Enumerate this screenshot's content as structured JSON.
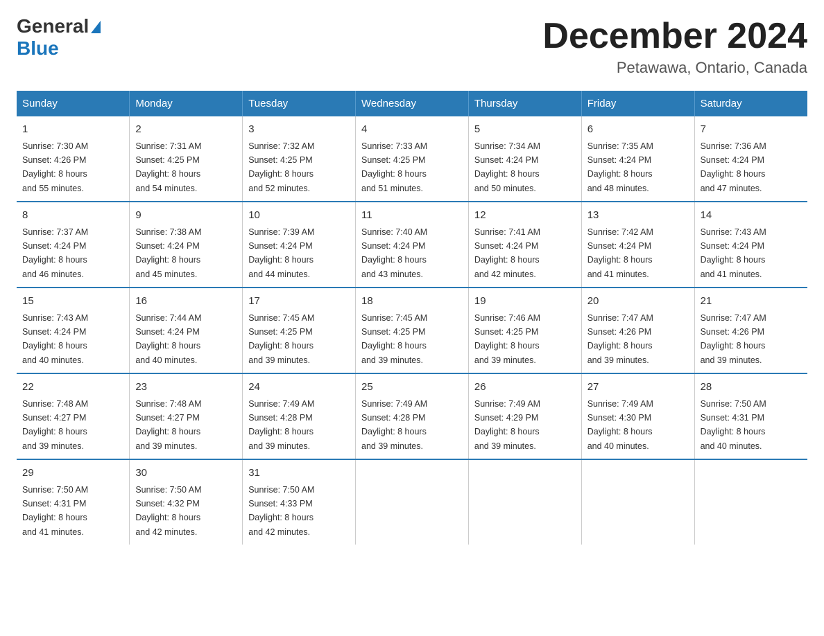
{
  "header": {
    "logo_general": "General",
    "logo_blue": "Blue",
    "month_title": "December 2024",
    "location": "Petawawa, Ontario, Canada"
  },
  "columns": [
    "Sunday",
    "Monday",
    "Tuesday",
    "Wednesday",
    "Thursday",
    "Friday",
    "Saturday"
  ],
  "weeks": [
    [
      {
        "day": "1",
        "sunrise": "7:30 AM",
        "sunset": "4:26 PM",
        "daylight": "8 hours and 55 minutes."
      },
      {
        "day": "2",
        "sunrise": "7:31 AM",
        "sunset": "4:25 PM",
        "daylight": "8 hours and 54 minutes."
      },
      {
        "day": "3",
        "sunrise": "7:32 AM",
        "sunset": "4:25 PM",
        "daylight": "8 hours and 52 minutes."
      },
      {
        "day": "4",
        "sunrise": "7:33 AM",
        "sunset": "4:25 PM",
        "daylight": "8 hours and 51 minutes."
      },
      {
        "day": "5",
        "sunrise": "7:34 AM",
        "sunset": "4:24 PM",
        "daylight": "8 hours and 50 minutes."
      },
      {
        "day": "6",
        "sunrise": "7:35 AM",
        "sunset": "4:24 PM",
        "daylight": "8 hours and 48 minutes."
      },
      {
        "day": "7",
        "sunrise": "7:36 AM",
        "sunset": "4:24 PM",
        "daylight": "8 hours and 47 minutes."
      }
    ],
    [
      {
        "day": "8",
        "sunrise": "7:37 AM",
        "sunset": "4:24 PM",
        "daylight": "8 hours and 46 minutes."
      },
      {
        "day": "9",
        "sunrise": "7:38 AM",
        "sunset": "4:24 PM",
        "daylight": "8 hours and 45 minutes."
      },
      {
        "day": "10",
        "sunrise": "7:39 AM",
        "sunset": "4:24 PM",
        "daylight": "8 hours and 44 minutes."
      },
      {
        "day": "11",
        "sunrise": "7:40 AM",
        "sunset": "4:24 PM",
        "daylight": "8 hours and 43 minutes."
      },
      {
        "day": "12",
        "sunrise": "7:41 AM",
        "sunset": "4:24 PM",
        "daylight": "8 hours and 42 minutes."
      },
      {
        "day": "13",
        "sunrise": "7:42 AM",
        "sunset": "4:24 PM",
        "daylight": "8 hours and 41 minutes."
      },
      {
        "day": "14",
        "sunrise": "7:43 AM",
        "sunset": "4:24 PM",
        "daylight": "8 hours and 41 minutes."
      }
    ],
    [
      {
        "day": "15",
        "sunrise": "7:43 AM",
        "sunset": "4:24 PM",
        "daylight": "8 hours and 40 minutes."
      },
      {
        "day": "16",
        "sunrise": "7:44 AM",
        "sunset": "4:24 PM",
        "daylight": "8 hours and 40 minutes."
      },
      {
        "day": "17",
        "sunrise": "7:45 AM",
        "sunset": "4:25 PM",
        "daylight": "8 hours and 39 minutes."
      },
      {
        "day": "18",
        "sunrise": "7:45 AM",
        "sunset": "4:25 PM",
        "daylight": "8 hours and 39 minutes."
      },
      {
        "day": "19",
        "sunrise": "7:46 AM",
        "sunset": "4:25 PM",
        "daylight": "8 hours and 39 minutes."
      },
      {
        "day": "20",
        "sunrise": "7:47 AM",
        "sunset": "4:26 PM",
        "daylight": "8 hours and 39 minutes."
      },
      {
        "day": "21",
        "sunrise": "7:47 AM",
        "sunset": "4:26 PM",
        "daylight": "8 hours and 39 minutes."
      }
    ],
    [
      {
        "day": "22",
        "sunrise": "7:48 AM",
        "sunset": "4:27 PM",
        "daylight": "8 hours and 39 minutes."
      },
      {
        "day": "23",
        "sunrise": "7:48 AM",
        "sunset": "4:27 PM",
        "daylight": "8 hours and 39 minutes."
      },
      {
        "day": "24",
        "sunrise": "7:49 AM",
        "sunset": "4:28 PM",
        "daylight": "8 hours and 39 minutes."
      },
      {
        "day": "25",
        "sunrise": "7:49 AM",
        "sunset": "4:28 PM",
        "daylight": "8 hours and 39 minutes."
      },
      {
        "day": "26",
        "sunrise": "7:49 AM",
        "sunset": "4:29 PM",
        "daylight": "8 hours and 39 minutes."
      },
      {
        "day": "27",
        "sunrise": "7:49 AM",
        "sunset": "4:30 PM",
        "daylight": "8 hours and 40 minutes."
      },
      {
        "day": "28",
        "sunrise": "7:50 AM",
        "sunset": "4:31 PM",
        "daylight": "8 hours and 40 minutes."
      }
    ],
    [
      {
        "day": "29",
        "sunrise": "7:50 AM",
        "sunset": "4:31 PM",
        "daylight": "8 hours and 41 minutes."
      },
      {
        "day": "30",
        "sunrise": "7:50 AM",
        "sunset": "4:32 PM",
        "daylight": "8 hours and 42 minutes."
      },
      {
        "day": "31",
        "sunrise": "7:50 AM",
        "sunset": "4:33 PM",
        "daylight": "8 hours and 42 minutes."
      },
      null,
      null,
      null,
      null
    ]
  ]
}
